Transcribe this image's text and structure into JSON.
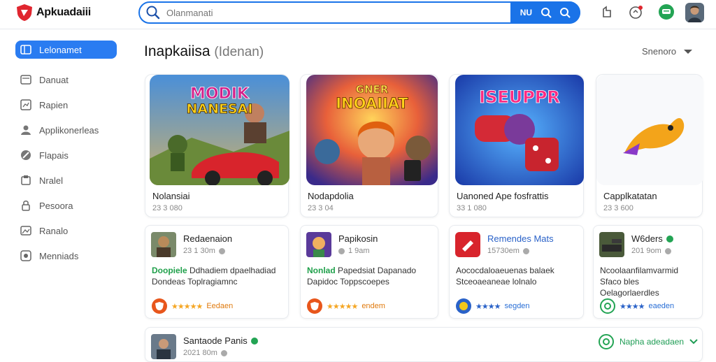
{
  "header": {
    "logo_text": "Apkuadaiii",
    "search_placeholder": "Olanmanati",
    "search_action_label": "NU"
  },
  "sidebar": {
    "items": [
      {
        "label": "Lelonamet",
        "icon": "app-grid-icon",
        "active": true
      },
      {
        "label": "Danuat",
        "icon": "inbox-icon"
      },
      {
        "label": "Rapien",
        "icon": "chart-icon"
      },
      {
        "label": "Applikonerleas",
        "icon": "user-icon"
      },
      {
        "label": "Flapais",
        "icon": "compass-icon"
      },
      {
        "label": "Nralel",
        "icon": "box-icon"
      },
      {
        "label": "Pesoora",
        "icon": "lock-icon"
      },
      {
        "label": "Ranalo",
        "icon": "image-icon"
      },
      {
        "label": "Menniads",
        "icon": "gamepad-icon"
      }
    ]
  },
  "section": {
    "title": "Inapkaiisa",
    "subtitle": "(Idenan)",
    "sort_label": "Snenoro"
  },
  "featured": [
    {
      "name": "Nolansiai",
      "meta": "23 3 080",
      "art_text": "MODIK NANESAI"
    },
    {
      "name": "Nodapdolia",
      "meta": "23 3 04",
      "art_text": "INOAIIAT"
    },
    {
      "name": "Uanoned Ape fosfrattis",
      "meta": "33 1 080",
      "art_text": "ISEUPPR"
    },
    {
      "name": "Capplkatatan",
      "meta": "23 3 600"
    }
  ],
  "details": [
    {
      "title": "Redaenaion",
      "meta": "23 1 30m",
      "highlight": "Doopiele",
      "desc": "Ddhadiem dpaelhadiad Dondeas Toplragiamnc",
      "rating": "Eedaen",
      "rating_color": "orange"
    },
    {
      "title": "Papikosin",
      "meta": "1 9am",
      "highlight": "Nonlad",
      "desc": "Papedsiat Dapanado Dapidoc Toppscoepes",
      "rating": "endem",
      "rating_color": "orange"
    },
    {
      "title": "Remendes Mats",
      "meta": "15730em",
      "highlight": "",
      "desc": "Aococdaloaeuenas balaek Stceoaeaneae lolnalo",
      "rating": "segden",
      "rating_color": "blue"
    },
    {
      "title": "W6ders",
      "meta": "201 9om",
      "highlight": "",
      "desc": "Ncoolaanfilamvarmid Sfaco bles Oelagorlaerdles",
      "rating": "eaeden",
      "rating_color": "blue"
    }
  ],
  "bottom_row": {
    "title": "Santaode Panis",
    "meta": "2021 80m",
    "action_label": "Napha adeadaen"
  }
}
